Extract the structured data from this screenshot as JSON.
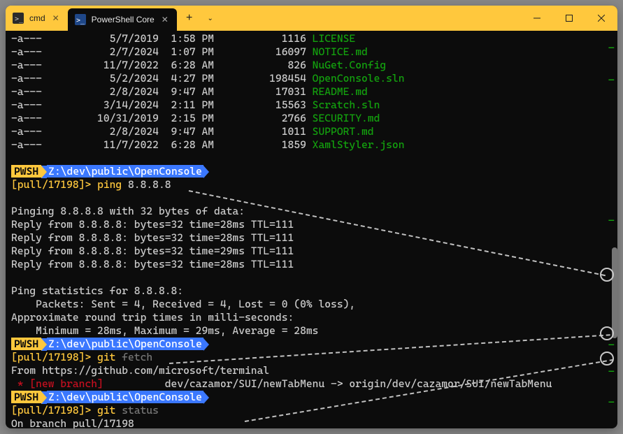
{
  "tabs": [
    {
      "label": "cmd",
      "active": false
    },
    {
      "label": "PowerShell Core",
      "active": true
    }
  ],
  "file_listing": [
    {
      "mode": "-a---",
      "date": "5/7/2019",
      "time": "1:58 PM",
      "size": "1116",
      "name": "LICENSE"
    },
    {
      "mode": "-a---",
      "date": "2/7/2024",
      "time": "1:07 PM",
      "size": "16097",
      "name": "NOTICE.md"
    },
    {
      "mode": "-a---",
      "date": "11/7/2022",
      "time": "6:28 AM",
      "size": "826",
      "name": "NuGet.Config"
    },
    {
      "mode": "-a---",
      "date": "5/2/2024",
      "time": "4:27 PM",
      "size": "198454",
      "name": "OpenConsole.sln"
    },
    {
      "mode": "-a---",
      "date": "2/8/2024",
      "time": "9:47 AM",
      "size": "17031",
      "name": "README.md"
    },
    {
      "mode": "-a---",
      "date": "3/14/2024",
      "time": "2:11 PM",
      "size": "15563",
      "name": "Scratch.sln"
    },
    {
      "mode": "-a---",
      "date": "10/31/2019",
      "time": "2:15 PM",
      "size": "2766",
      "name": "SECURITY.md"
    },
    {
      "mode": "-a---",
      "date": "2/8/2024",
      "time": "9:47 AM",
      "size": "1011",
      "name": "SUPPORT.md"
    },
    {
      "mode": "-a---",
      "date": "11/7/2022",
      "time": "6:28 AM",
      "size": "1859",
      "name": "XamlStyler.json"
    }
  ],
  "prompt": {
    "shell": "PWSH",
    "path": "Z:\\dev\\public\\OpenConsole",
    "branch": "[pull/17198]",
    "arrow": ">"
  },
  "cmd1": {
    "cmd": "ping",
    "arg": "8.8.8.8"
  },
  "ping": {
    "header": "Pinging 8.8.8.8 with 32 bytes of data:",
    "r1": "Reply from 8.8.8.8: bytes=32 time=28ms TTL=111",
    "r2": "Reply from 8.8.8.8: bytes=32 time=28ms TTL=111",
    "r3": "Reply from 8.8.8.8: bytes=32 time=29ms TTL=111",
    "r4": "Reply from 8.8.8.8: bytes=32 time=28ms TTL=111",
    "stats_hdr": "Ping statistics for 8.8.8.8:",
    "packets": "    Packets: Sent = 4, Received = 4, Lost = 0 (0% loss),",
    "approx": "Approximate round trip times in milli-seconds:",
    "times": "    Minimum = 28ms, Maximum = 29ms, Average = 28ms"
  },
  "cmd2": {
    "cmd": "git",
    "arg": "fetch"
  },
  "fetch": {
    "from": "From https://github.com/microsoft/terminal",
    "branch_line_p1": " * [new branch]          ",
    "branch_line_p2": "dev/cazamor/SUI/newTabMenu -> origin/dev/cazamor/SUI/newTabMenu"
  },
  "cmd3": {
    "cmd": "git",
    "arg": "status"
  },
  "status": {
    "line1": "On branch pull/17198"
  }
}
